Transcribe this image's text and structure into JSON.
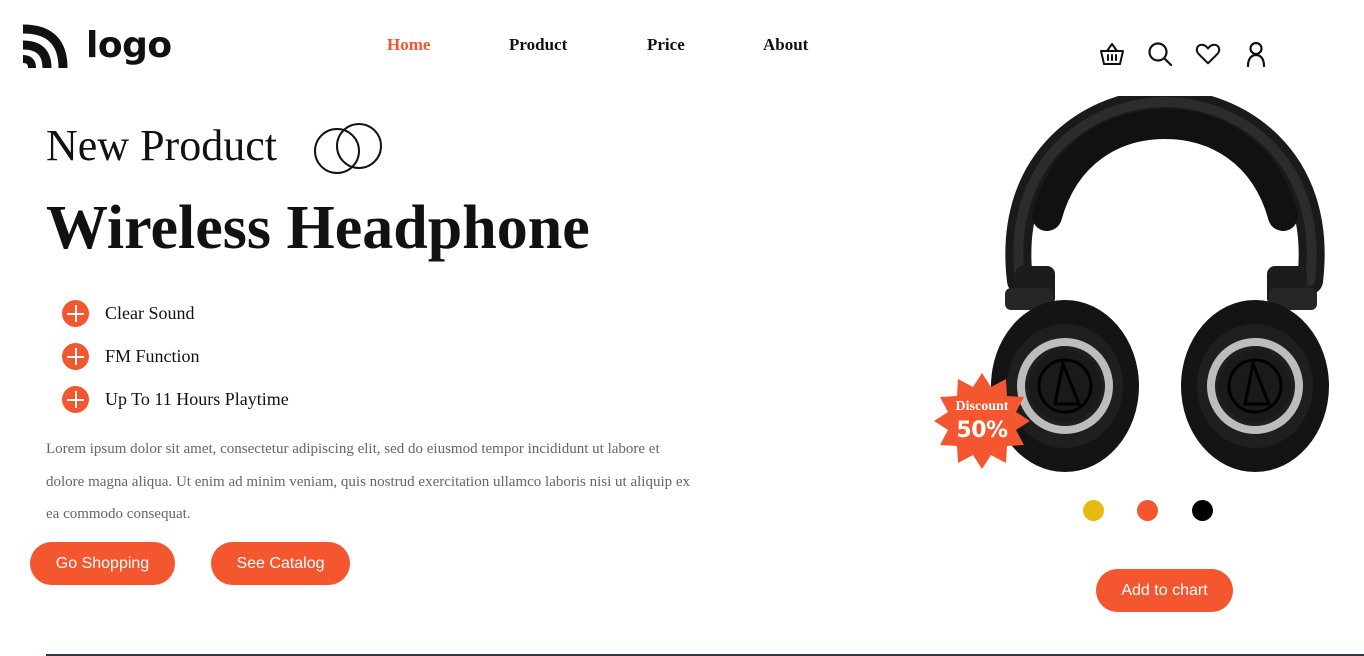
{
  "header": {
    "logo_text": "logo",
    "nav": [
      {
        "label": "Home",
        "active": true
      },
      {
        "label": "Product",
        "active": false
      },
      {
        "label": "Price",
        "active": false
      },
      {
        "label": "About",
        "active": false
      }
    ],
    "icons": [
      "basket-icon",
      "search-icon",
      "heart-icon",
      "user-icon"
    ]
  },
  "hero": {
    "eyebrow": "New Product",
    "title": "Wireless Headphone",
    "features": [
      "Clear Sound",
      "FM Function",
      "Up To 11 Hours Playtime"
    ],
    "description": "Lorem ipsum dolor sit amet, consectetur adipiscing elit, sed do eiusmod tempor incididunt ut labore et dolore magna aliqua. Ut enim ad minim veniam, quis nostrud exercitation ullamco laboris nisi ut aliquip ex ea commodo consequat.",
    "buttons": {
      "shop": "Go Shopping",
      "catalog": "See Catalog"
    }
  },
  "product": {
    "badge": {
      "label": "Discount",
      "value": "50%"
    },
    "colors": [
      "#e9b913",
      "#f4572f",
      "#000000"
    ],
    "add_to_cart": "Add to chart"
  },
  "theme": {
    "accent": "#f4572f",
    "text": "#111111",
    "muted": "#666666"
  }
}
